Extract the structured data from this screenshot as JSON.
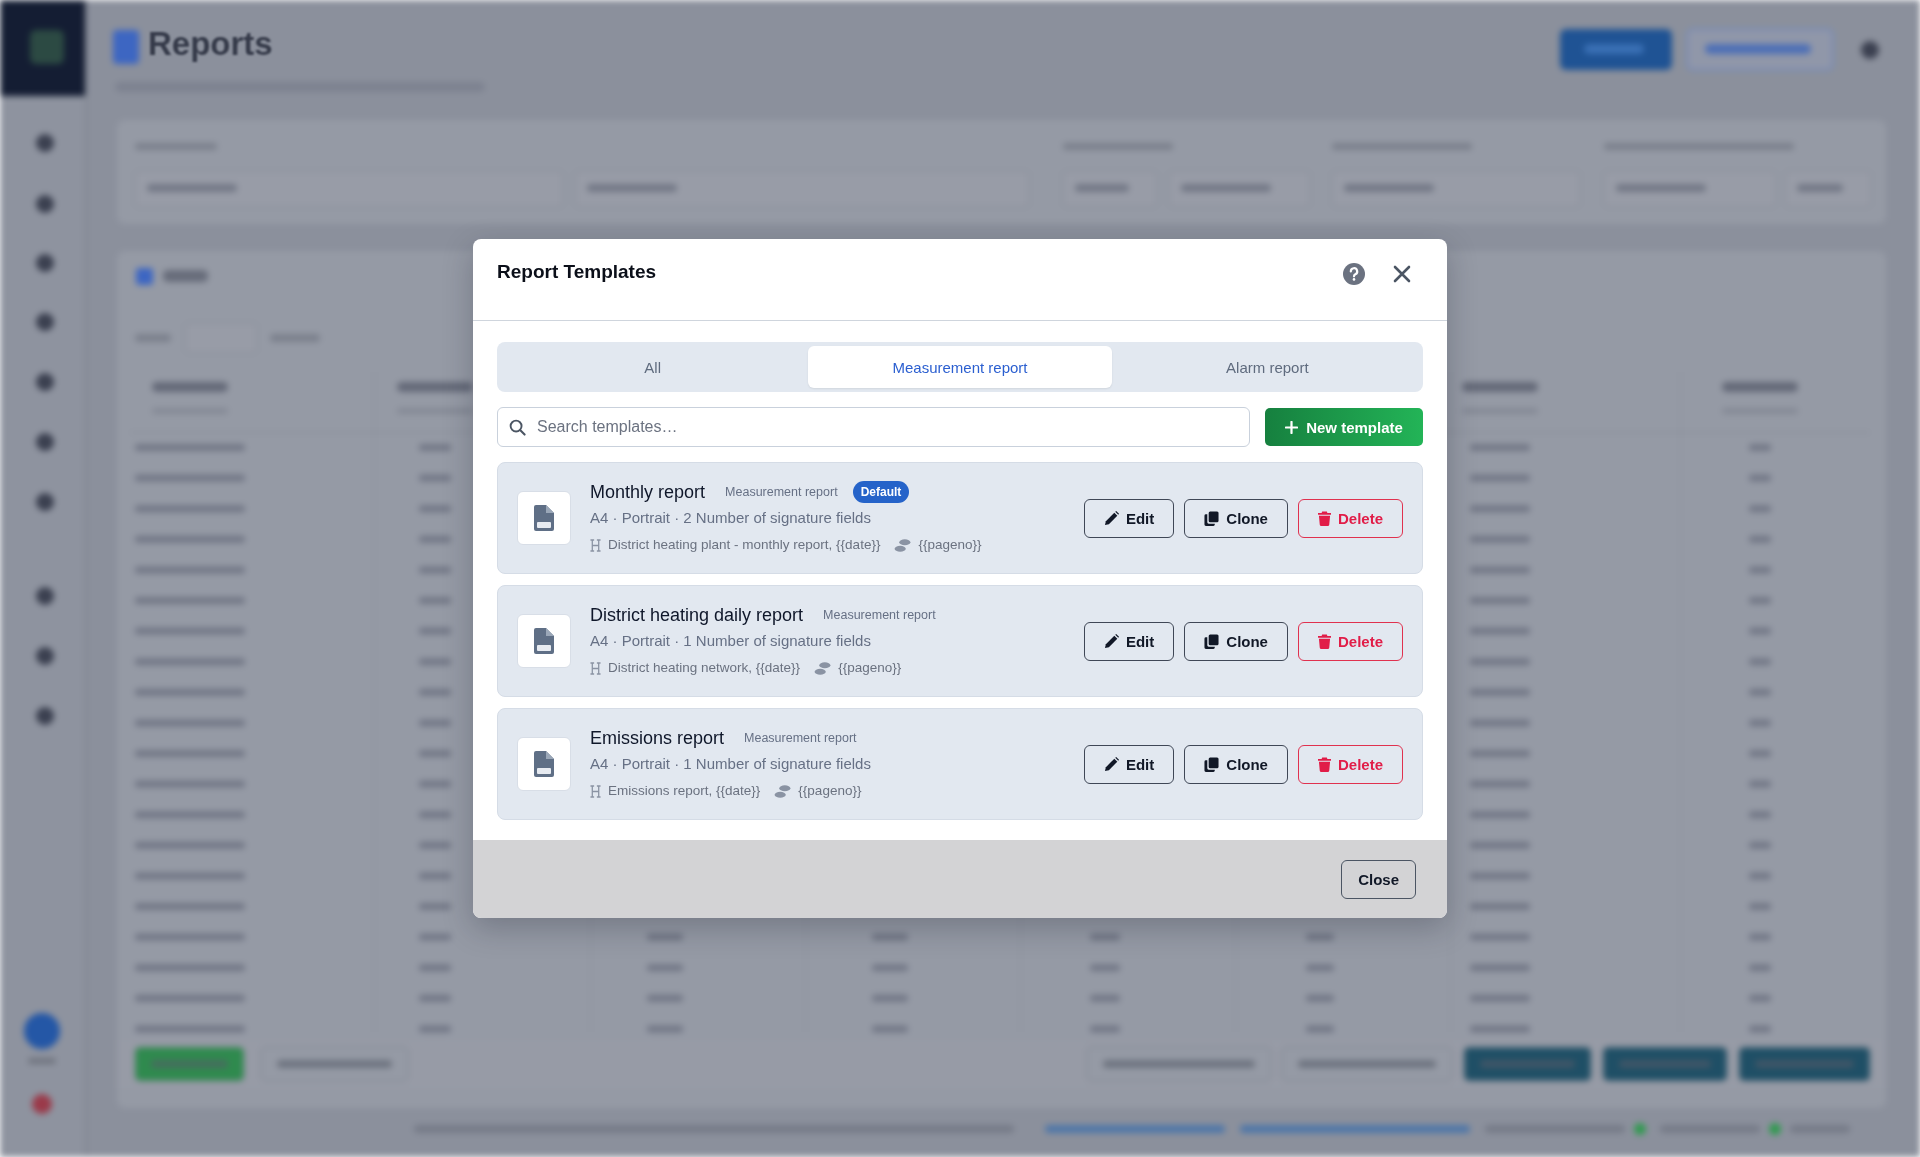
{
  "backdrop": {
    "title": "Reports"
  },
  "dialog": {
    "title": "Report Templates",
    "tabs": [
      {
        "label": "All",
        "selected": false
      },
      {
        "label": "Measurement report",
        "selected": true
      },
      {
        "label": "Alarm report",
        "selected": false
      }
    ],
    "search": {
      "placeholder": "Search templates…"
    },
    "new_template_button": {
      "label": "New template"
    },
    "templates": [
      {
        "name": "Monthly report",
        "type": "Measurement report",
        "badge": "Default",
        "details": "A4 · Portrait · 2 Number of signature fields",
        "header": "District heating plant - monthly report, {{date}}",
        "footer": "{{pageno}}",
        "actions": [
          {
            "kind": "edit",
            "label": "Edit"
          },
          {
            "kind": "clone",
            "label": "Clone"
          },
          {
            "kind": "delete",
            "label": "Delete"
          }
        ]
      },
      {
        "name": "District heating daily report",
        "type": "Measurement report",
        "details": "A4 · Portrait · 1 Number of signature fields",
        "header": "District heating network, {{date}}",
        "footer": "{{pageno}}",
        "actions": [
          {
            "kind": "edit",
            "label": "Edit"
          },
          {
            "kind": "clone",
            "label": "Clone"
          },
          {
            "kind": "delete",
            "label": "Delete"
          }
        ]
      },
      {
        "name": "Emissions report",
        "type": "Measurement report",
        "details": "A4 · Portrait · 1 Number of signature fields",
        "header": "Emissions report, {{date}}",
        "footer": "{{pageno}}",
        "actions": [
          {
            "kind": "edit",
            "label": "Edit"
          },
          {
            "kind": "clone",
            "label": "Clone"
          },
          {
            "kind": "delete",
            "label": "Delete"
          }
        ]
      }
    ],
    "close_button": {
      "label": "Close"
    }
  }
}
